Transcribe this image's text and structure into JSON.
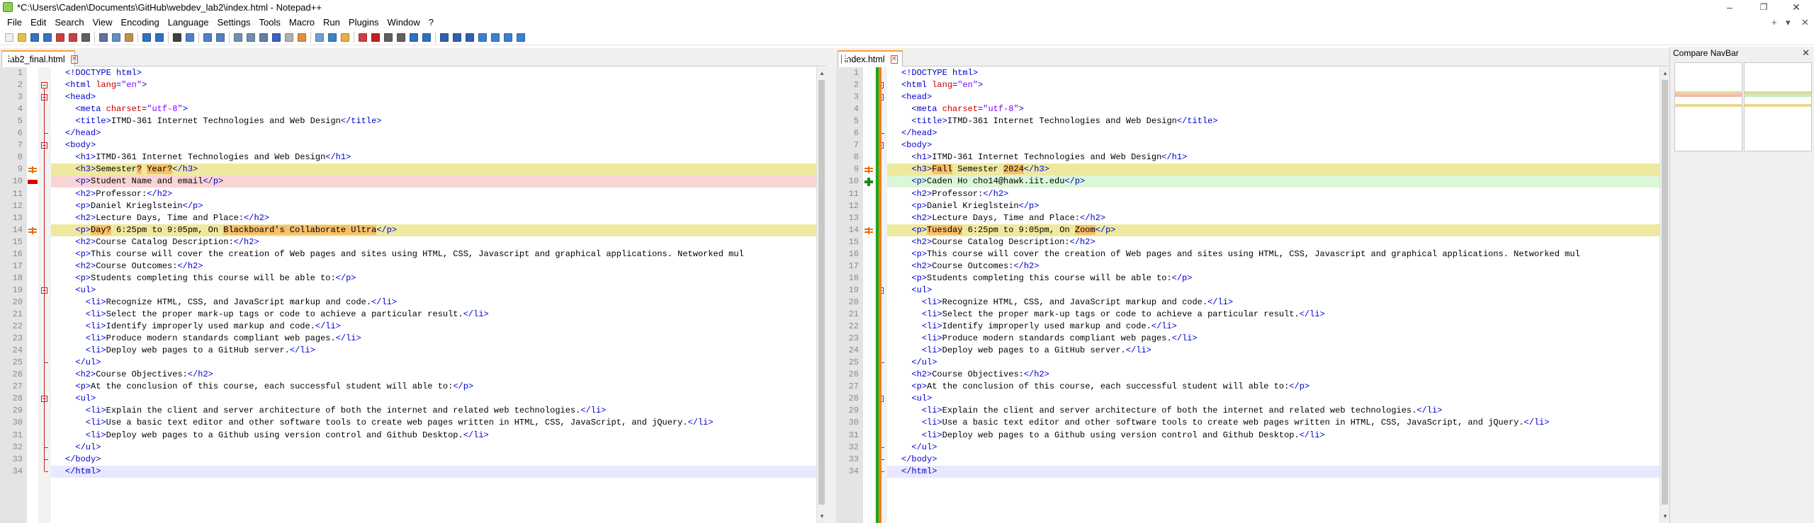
{
  "window": {
    "title": "*C:\\Users\\Caden\\Documents\\GitHub\\webdev_lab2\\index.html - Notepad++",
    "min_glyph": "–",
    "max_glyph": "❐",
    "close_glyph": "✕"
  },
  "menu": {
    "items": [
      "File",
      "Edit",
      "Search",
      "View",
      "Encoding",
      "Language",
      "Settings",
      "Tools",
      "Macro",
      "Run",
      "Plugins",
      "Window",
      "?"
    ],
    "right": [
      "+",
      "▾",
      "✕"
    ]
  },
  "left_tab": {
    "label": "lab2_final.html",
    "close": "✕"
  },
  "right_tab": {
    "label": "index.html",
    "close": "✕"
  },
  "navbar": {
    "title": "Compare NavBar",
    "close": "✕"
  },
  "colors": {
    "changed_line": "#efe9a0",
    "removed_line": "#f9d4d4",
    "added_line": "#dcf6d8",
    "current_line": "#e8e8ff",
    "tag": "#0000cc",
    "attr": "#cc0000",
    "string": "#8000ff",
    "word_highlight": "#f8c06a"
  },
  "icons": [
    "new-file-icon",
    "open-icon",
    "save-icon",
    "save-all-icon",
    "close-icon",
    "close-all-icon",
    "print-icon",
    "cut-icon",
    "copy-icon",
    "paste-icon",
    "undo-icon",
    "redo-icon",
    "find-icon",
    "replace-icon",
    "zoom-in-icon",
    "zoom-out-icon",
    "sync-v-icon",
    "sync-h-icon",
    "wrap-icon",
    "all-chars-icon",
    "indent-guide-icon",
    "udl-icon",
    "doc-map-icon",
    "func-list-icon",
    "folder-icon",
    "monitor-icon",
    "record-icon",
    "stop-icon",
    "play-icon",
    "play-multi-icon",
    "save-macro-icon",
    "compare-icon",
    "compare-clear-icon",
    "navbar-icon",
    "prev-diff-icon",
    "next-diff-icon",
    "first-diff-icon",
    "settings-icon"
  ],
  "left_lines": [
    [
      [
        "t",
        "<!DOCTYPE html>"
      ]
    ],
    [
      [
        "t",
        "<html "
      ],
      [
        "a",
        "lang"
      ],
      [
        "t",
        "="
      ],
      [
        "s",
        "\"en\""
      ],
      [
        "t",
        ">"
      ]
    ],
    [
      [
        "t",
        "<head>"
      ]
    ],
    [
      [
        "p",
        "  "
      ],
      [
        "t",
        "<meta "
      ],
      [
        "a",
        "charset"
      ],
      [
        "t",
        "="
      ],
      [
        "s",
        "\"utf-8\""
      ],
      [
        "t",
        ">"
      ]
    ],
    [
      [
        "p",
        "  "
      ],
      [
        "t",
        "<title>"
      ],
      [
        "p",
        "ITMD-361 Internet Technologies and Web Design"
      ],
      [
        "t",
        "</title>"
      ]
    ],
    [
      [
        "t",
        "</head>"
      ]
    ],
    [
      [
        "t",
        "<body>"
      ]
    ],
    [
      [
        "p",
        "  "
      ],
      [
        "t",
        "<h1>"
      ],
      [
        "p",
        "ITMD-361 Internet Technologies and Web Design"
      ],
      [
        "t",
        "</h1>"
      ]
    ],
    [
      [
        "p",
        "  "
      ],
      [
        "t",
        "<h3>"
      ],
      [
        "p",
        "Semester"
      ],
      [
        "h",
        "?"
      ],
      [
        "p",
        " "
      ],
      [
        "h",
        "Year?"
      ],
      [
        "t",
        "</h3>"
      ]
    ],
    [
      [
        "p",
        "  "
      ],
      [
        "t",
        "<p>"
      ],
      [
        "p",
        "Student Name and email"
      ],
      [
        "t",
        "</p>"
      ]
    ],
    [
      [
        "p",
        "  "
      ],
      [
        "t",
        "<h2>"
      ],
      [
        "p",
        "Professor:"
      ],
      [
        "t",
        "</h2>"
      ]
    ],
    [
      [
        "p",
        "  "
      ],
      [
        "t",
        "<p>"
      ],
      [
        "p",
        "Daniel Krieglstein"
      ],
      [
        "t",
        "</p>"
      ]
    ],
    [
      [
        "p",
        "  "
      ],
      [
        "t",
        "<h2>"
      ],
      [
        "p",
        "Lecture Days, Time and Place:"
      ],
      [
        "t",
        "</h2>"
      ]
    ],
    [
      [
        "p",
        "  "
      ],
      [
        "t",
        "<p>"
      ],
      [
        "h",
        "Day?"
      ],
      [
        "p",
        " 6:25pm to 9:05pm, On "
      ],
      [
        "h",
        "Blackboard's Collaborate Ultra"
      ],
      [
        "t",
        "</p>"
      ]
    ],
    [
      [
        "p",
        "  "
      ],
      [
        "t",
        "<h2>"
      ],
      [
        "p",
        "Course Catalog Description:"
      ],
      [
        "t",
        "</h2>"
      ]
    ],
    [
      [
        "p",
        "  "
      ],
      [
        "t",
        "<p>"
      ],
      [
        "p",
        "This course will cover the creation of Web pages and sites using HTML, CSS, Javascript and graphical applications. Networked mul"
      ]
    ],
    [
      [
        "p",
        "  "
      ],
      [
        "t",
        "<h2>"
      ],
      [
        "p",
        "Course Outcomes:"
      ],
      [
        "t",
        "</h2>"
      ]
    ],
    [
      [
        "p",
        "  "
      ],
      [
        "t",
        "<p>"
      ],
      [
        "p",
        "Students completing this course will be able to:"
      ],
      [
        "t",
        "</p>"
      ]
    ],
    [
      [
        "p",
        "  "
      ],
      [
        "t",
        "<ul>"
      ]
    ],
    [
      [
        "p",
        "    "
      ],
      [
        "t",
        "<li>"
      ],
      [
        "p",
        "Recognize HTML, CSS, and JavaScript markup and code."
      ],
      [
        "t",
        "</li>"
      ]
    ],
    [
      [
        "p",
        "    "
      ],
      [
        "t",
        "<li>"
      ],
      [
        "p",
        "Select the proper mark-up tags or code to achieve a particular result."
      ],
      [
        "t",
        "</li>"
      ]
    ],
    [
      [
        "p",
        "    "
      ],
      [
        "t",
        "<li>"
      ],
      [
        "p",
        "Identify improperly used markup and code."
      ],
      [
        "t",
        "</li>"
      ]
    ],
    [
      [
        "p",
        "    "
      ],
      [
        "t",
        "<li>"
      ],
      [
        "p",
        "Produce modern standards compliant web pages."
      ],
      [
        "t",
        "</li>"
      ]
    ],
    [
      [
        "p",
        "    "
      ],
      [
        "t",
        "<li>"
      ],
      [
        "p",
        "Deploy web pages to a GitHub server."
      ],
      [
        "t",
        "</li>"
      ]
    ],
    [
      [
        "p",
        "  "
      ],
      [
        "t",
        "</ul>"
      ]
    ],
    [
      [
        "p",
        "  "
      ],
      [
        "t",
        "<h2>"
      ],
      [
        "p",
        "Course Objectives:"
      ],
      [
        "t",
        "</h2>"
      ]
    ],
    [
      [
        "p",
        "  "
      ],
      [
        "t",
        "<p>"
      ],
      [
        "p",
        "At the conclusion of this course, each successful student will able to:"
      ],
      [
        "t",
        "</p>"
      ]
    ],
    [
      [
        "p",
        "  "
      ],
      [
        "t",
        "<ul>"
      ]
    ],
    [
      [
        "p",
        "    "
      ],
      [
        "t",
        "<li>"
      ],
      [
        "p",
        "Explain the client and server architecture of both the internet and related web technologies."
      ],
      [
        "t",
        "</li>"
      ]
    ],
    [
      [
        "p",
        "    "
      ],
      [
        "t",
        "<li>"
      ],
      [
        "p",
        "Use a basic text editor and other software tools to create web pages written in HTML, CSS, JavaScript, and jQuery."
      ],
      [
        "t",
        "</li>"
      ]
    ],
    [
      [
        "p",
        "    "
      ],
      [
        "t",
        "<li>"
      ],
      [
        "p",
        "Deploy web pages to a Github using version control and Github Desktop."
      ],
      [
        "t",
        "</li>"
      ]
    ],
    [
      [
        "p",
        "  "
      ],
      [
        "t",
        "</ul>"
      ]
    ],
    [
      [
        "t",
        "</body>"
      ]
    ],
    [
      [
        "t",
        "</html>"
      ]
    ]
  ],
  "right_lines": [
    [
      [
        "t",
        "<!DOCTYPE html>"
      ]
    ],
    [
      [
        "t",
        "<html "
      ],
      [
        "a",
        "lang"
      ],
      [
        "t",
        "="
      ],
      [
        "s",
        "\"en\""
      ],
      [
        "t",
        ">"
      ]
    ],
    [
      [
        "t",
        "<head>"
      ]
    ],
    [
      [
        "p",
        "  "
      ],
      [
        "t",
        "<meta "
      ],
      [
        "a",
        "charset"
      ],
      [
        "t",
        "="
      ],
      [
        "s",
        "\"utf-8\""
      ],
      [
        "t",
        ">"
      ]
    ],
    [
      [
        "p",
        "  "
      ],
      [
        "t",
        "<title>"
      ],
      [
        "p",
        "ITMD-361 Internet Technologies and Web Design"
      ],
      [
        "t",
        "</title>"
      ]
    ],
    [
      [
        "t",
        "</head>"
      ]
    ],
    [
      [
        "t",
        "<body>"
      ]
    ],
    [
      [
        "p",
        "  "
      ],
      [
        "t",
        "<h1>"
      ],
      [
        "p",
        "ITMD-361 Internet Technologies and Web Design"
      ],
      [
        "t",
        "</h1>"
      ]
    ],
    [
      [
        "p",
        "  "
      ],
      [
        "t",
        "<h3>"
      ],
      [
        "h",
        "Fall"
      ],
      [
        "p",
        " Semester "
      ],
      [
        "h",
        "2024"
      ],
      [
        "t",
        "</h3>"
      ]
    ],
    [
      [
        "p",
        "  "
      ],
      [
        "t",
        "<p>"
      ],
      [
        "p",
        "Caden Ho cho14@hawk.iit.edu"
      ],
      [
        "t",
        "</p>"
      ]
    ],
    [
      [
        "p",
        "  "
      ],
      [
        "t",
        "<h2>"
      ],
      [
        "p",
        "Professor:"
      ],
      [
        "t",
        "</h2>"
      ]
    ],
    [
      [
        "p",
        "  "
      ],
      [
        "t",
        "<p>"
      ],
      [
        "p",
        "Daniel Krieglstein"
      ],
      [
        "t",
        "</p>"
      ]
    ],
    [
      [
        "p",
        "  "
      ],
      [
        "t",
        "<h2>"
      ],
      [
        "p",
        "Lecture Days, Time and Place:"
      ],
      [
        "t",
        "</h2>"
      ]
    ],
    [
      [
        "p",
        "  "
      ],
      [
        "t",
        "<p>"
      ],
      [
        "h",
        "Tuesday"
      ],
      [
        "p",
        " 6:25pm to 9:05pm, On "
      ],
      [
        "h",
        "Zoom"
      ],
      [
        "t",
        "</p>"
      ]
    ],
    [
      [
        "p",
        "  "
      ],
      [
        "t",
        "<h2>"
      ],
      [
        "p",
        "Course Catalog Description:"
      ],
      [
        "t",
        "</h2>"
      ]
    ],
    [
      [
        "p",
        "  "
      ],
      [
        "t",
        "<p>"
      ],
      [
        "p",
        "This course will cover the creation of Web pages and sites using HTML, CSS, Javascript and graphical applications. Networked mul"
      ]
    ],
    [
      [
        "p",
        "  "
      ],
      [
        "t",
        "<h2>"
      ],
      [
        "p",
        "Course Outcomes:"
      ],
      [
        "t",
        "</h2>"
      ]
    ],
    [
      [
        "p",
        "  "
      ],
      [
        "t",
        "<p>"
      ],
      [
        "p",
        "Students completing this course will be able to:"
      ],
      [
        "t",
        "</p>"
      ]
    ],
    [
      [
        "p",
        "  "
      ],
      [
        "t",
        "<ul>"
      ]
    ],
    [
      [
        "p",
        "    "
      ],
      [
        "t",
        "<li>"
      ],
      [
        "p",
        "Recognize HTML, CSS, and JavaScript markup and code."
      ],
      [
        "t",
        "</li>"
      ]
    ],
    [
      [
        "p",
        "    "
      ],
      [
        "t",
        "<li>"
      ],
      [
        "p",
        "Select the proper mark-up tags or code to achieve a particular result."
      ],
      [
        "t",
        "</li>"
      ]
    ],
    [
      [
        "p",
        "    "
      ],
      [
        "t",
        "<li>"
      ],
      [
        "p",
        "Identify improperly used markup and code."
      ],
      [
        "t",
        "</li>"
      ]
    ],
    [
      [
        "p",
        "    "
      ],
      [
        "t",
        "<li>"
      ],
      [
        "p",
        "Produce modern standards compliant web pages."
      ],
      [
        "t",
        "</li>"
      ]
    ],
    [
      [
        "p",
        "    "
      ],
      [
        "t",
        "<li>"
      ],
      [
        "p",
        "Deploy web pages to a GitHub server."
      ],
      [
        "t",
        "</li>"
      ]
    ],
    [
      [
        "p",
        "  "
      ],
      [
        "t",
        "</ul>"
      ]
    ],
    [
      [
        "p",
        "  "
      ],
      [
        "t",
        "<h2>"
      ],
      [
        "p",
        "Course Objectives:"
      ],
      [
        "t",
        "</h2>"
      ]
    ],
    [
      [
        "p",
        "  "
      ],
      [
        "t",
        "<p>"
      ],
      [
        "p",
        "At the conclusion of this course, each successful student will able to:"
      ],
      [
        "t",
        "</p>"
      ]
    ],
    [
      [
        "p",
        "  "
      ],
      [
        "t",
        "<ul>"
      ]
    ],
    [
      [
        "p",
        "    "
      ],
      [
        "t",
        "<li>"
      ],
      [
        "p",
        "Explain the client and server architecture of both the internet and related web technologies."
      ],
      [
        "t",
        "</li>"
      ]
    ],
    [
      [
        "p",
        "    "
      ],
      [
        "t",
        "<li>"
      ],
      [
        "p",
        "Use a basic text editor and other software tools to create web pages written in HTML, CSS, JavaScript, and jQuery."
      ],
      [
        "t",
        "</li>"
      ]
    ],
    [
      [
        "p",
        "    "
      ],
      [
        "t",
        "<li>"
      ],
      [
        "p",
        "Deploy web pages to a Github using version control and Github Desktop."
      ],
      [
        "t",
        "</li>"
      ]
    ],
    [
      [
        "p",
        "  "
      ],
      [
        "t",
        "</ul>"
      ]
    ],
    [
      [
        "t",
        "</body>"
      ]
    ],
    [
      [
        "t",
        "</html>"
      ]
    ]
  ],
  "diff": {
    "left_changed": [
      9,
      14
    ],
    "left_removed": [
      10
    ],
    "right_changed": [
      9,
      14
    ],
    "right_added": [
      10
    ],
    "current_line": 34
  },
  "folds": {
    "open": [
      2,
      3,
      7,
      19,
      28
    ],
    "end": [
      6,
      25,
      32,
      33,
      34
    ]
  }
}
